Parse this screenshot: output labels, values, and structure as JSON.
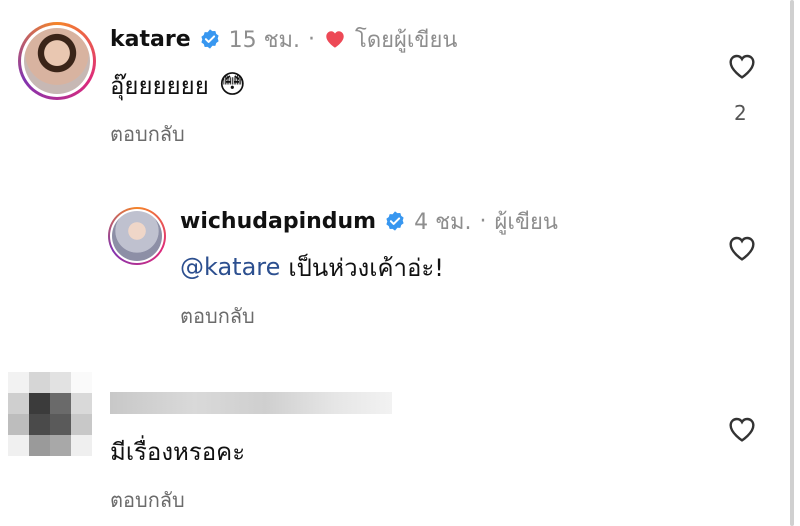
{
  "colors": {
    "verified": "#3897f0",
    "like_red": "#ed4956",
    "mention": "#2c4f8f",
    "meta": "#8e8e8e"
  },
  "comments": [
    {
      "username": "katare",
      "time": "15 ชม.",
      "dot": "·",
      "liked_by": "โดยผู้เขียน",
      "text": "อุ๊ยยยยยย",
      "emoji": "😳",
      "reply_label": "ตอบกลับ",
      "likes": "2",
      "icons": {
        "verified": "verified-badge-icon",
        "liked": "heart-filled-icon",
        "like": "heart-outline-icon"
      }
    },
    {
      "username": "wichudapindum",
      "time": "4 ชม.",
      "dot": "·",
      "author_label": "ผู้เขียน",
      "mention": "@katare",
      "text": "เป็นห่วงเค้าอ่ะ!",
      "reply_label": "ตอบกลับ",
      "icons": {
        "verified": "verified-badge-icon",
        "like": "heart-outline-icon"
      }
    },
    {
      "text": "มีเรื่องหรอคะ",
      "reply_label": "ตอบกลับ",
      "icons": {
        "like": "heart-outline-icon"
      }
    }
  ]
}
